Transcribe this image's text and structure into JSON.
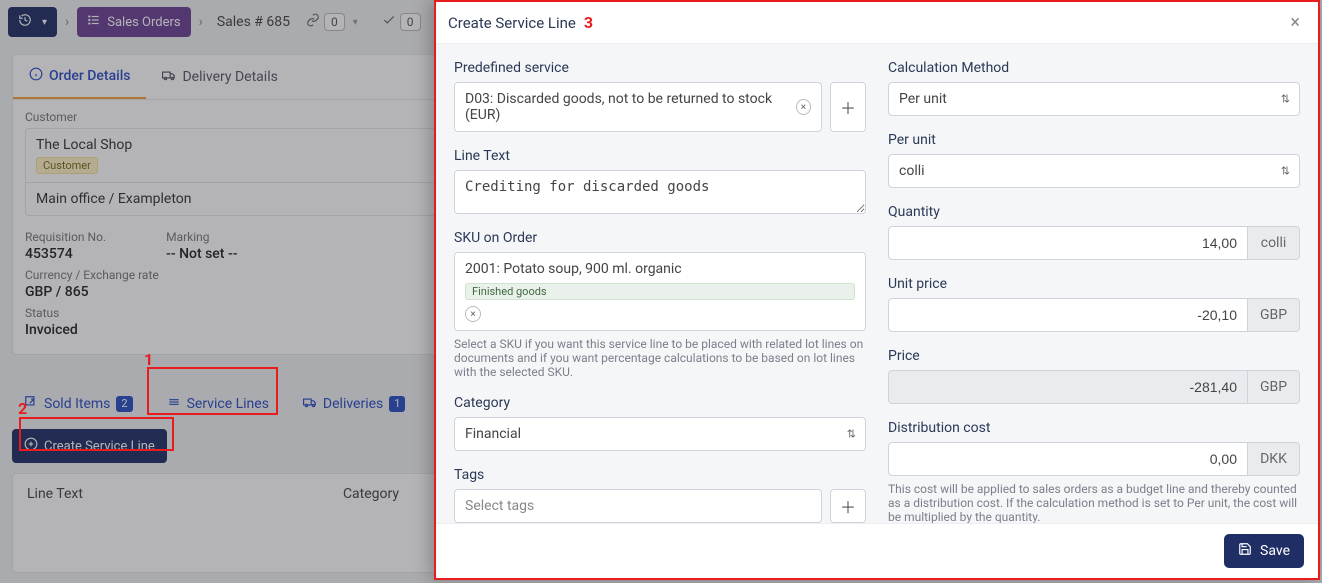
{
  "toolbar": {
    "sales_orders_label": "Sales Orders",
    "breadcrumb_order": "Sales # 685",
    "link_badge": "0",
    "ok_badge": "0"
  },
  "tabs": {
    "order_details": "Order Details",
    "delivery_details": "Delivery Details"
  },
  "details": {
    "customer_label": "Customer",
    "customer_name": "The Local Shop",
    "customer_tag": "Customer",
    "customer_address": "Main office / Exampleton",
    "req_label": "Requisition No.",
    "req_value": "453574",
    "marking_label": "Marking",
    "marking_value": "-- Not set --",
    "curr_label": "Currency / Exchange rate",
    "curr_value": "GBP / 865",
    "status_label": "Status",
    "status_value": "Invoiced"
  },
  "lower_tabs": {
    "sold_items": {
      "label": "Sold Items",
      "count": "2"
    },
    "service_lines": {
      "label": "Service Lines"
    },
    "deliveries": {
      "label": "Deliveries",
      "count": "1"
    }
  },
  "create_button": "Create Service Line",
  "grid": {
    "col_line_text": "Line Text",
    "col_category": "Category"
  },
  "annotations": {
    "n1": "1",
    "n2": "2",
    "n3": "3"
  },
  "modal": {
    "title": "Create Service Line",
    "left": {
      "predefined_label": "Predefined service",
      "predefined_value": "D03: Discarded goods, not to be returned to stock (EUR)",
      "line_text_label": "Line Text",
      "line_text_value": "Crediting for discarded goods",
      "sku_label": "SKU on Order",
      "sku_value": "2001: Potato soup, 900 ml. organic",
      "sku_tag": "Finished goods",
      "sku_hint": "Select a SKU if you want this service line to be placed with related lot lines on documents and if you want percentage calculations to be based on lot lines with the selected SKU.",
      "category_label": "Category",
      "category_value": "Financial",
      "tags_label": "Tags",
      "tags_placeholder": "Select tags"
    },
    "right": {
      "calc_label": "Calculation Method",
      "calc_value": "Per unit",
      "per_unit_label": "Per unit",
      "per_unit_value": "colli",
      "qty_label": "Quantity",
      "qty_value": "14,00",
      "qty_unit": "colli",
      "unit_price_label": "Unit price",
      "unit_price_value": "-20,10",
      "unit_price_curr": "GBP",
      "price_label": "Price",
      "price_value": "-281,40",
      "price_curr": "GBP",
      "dist_label": "Distribution cost",
      "dist_value": "0,00",
      "dist_curr": "DKK",
      "dist_hint": "This cost will be applied to sales orders as a budget line and thereby counted as a distribution cost. If the calculation method is set to Per unit, the cost will be multiplied by the quantity."
    },
    "save_label": "Save"
  }
}
